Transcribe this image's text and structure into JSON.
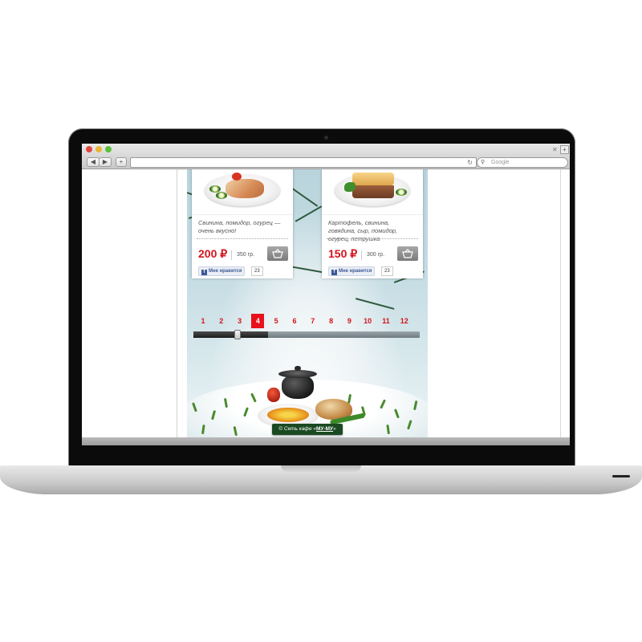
{
  "browser": {
    "search_placeholder": "Google",
    "back_label": "◀",
    "forward_label": "▶",
    "add_label": "+",
    "reload_label": "↻",
    "tab_close": "✕",
    "tab_add": "+"
  },
  "products": [
    {
      "description": "Свинина, помидор, огурец — очень вкусно!",
      "price": "200 ₽",
      "weight": "350 гр.",
      "like_label": "Мне нравится",
      "like_count": "23",
      "photo": "pork-plate"
    },
    {
      "description": "Картофель, свинина, говядина, сыр, помидор, огурец, петрушка",
      "price": "150 ₽",
      "weight": "300 гр.",
      "like_label": "Мне нравится",
      "like_count": "23",
      "photo": "pie-plate"
    }
  ],
  "pagination": {
    "pages": [
      "1",
      "2",
      "3",
      "4",
      "5",
      "6",
      "7",
      "8",
      "9",
      "10",
      "11",
      "12"
    ],
    "current": "4",
    "slider_progress": 0.33
  },
  "footer": {
    "prefix": "© Сеть кафе «",
    "brand": "МУ-МУ",
    "suffix": "»"
  },
  "colors": {
    "accent_red": "#e8101a",
    "price_red": "#d4141c",
    "footer_green": "#1b4a22",
    "facebook_blue": "#3b5998"
  }
}
